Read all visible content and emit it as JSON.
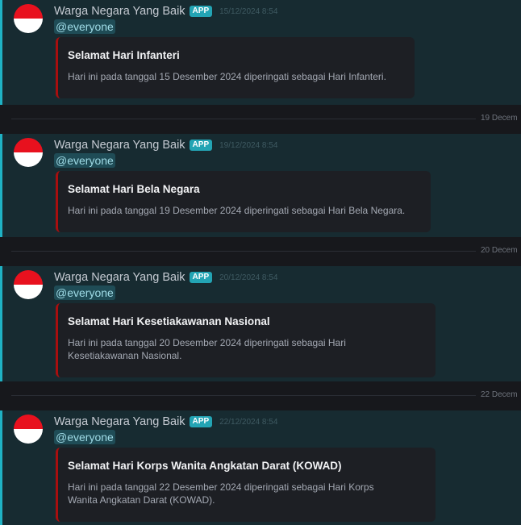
{
  "messages": [
    {
      "author": "Warga Negara Yang Baik",
      "badge": "APP",
      "timestamp": "15/12/2024 8:54",
      "mention": "@everyone",
      "embed_title": "Selamat Hari Infanteri",
      "embed_description": "Hari ini pada tanggal 15 Desember 2024 diperingati sebagai Hari Infanteri."
    },
    {
      "author": "Warga Negara Yang Baik",
      "badge": "APP",
      "timestamp": "19/12/2024 8:54",
      "mention": "@everyone",
      "embed_title": "Selamat Hari Bela Negara",
      "embed_description": "Hari ini pada tanggal 19 Desember 2024 diperingati sebagai Hari Bela Negara."
    },
    {
      "author": "Warga Negara Yang Baik",
      "badge": "APP",
      "timestamp": "20/12/2024 8:54",
      "mention": "@everyone",
      "embed_title": "Selamat Hari Kesetiakawanan Nasional",
      "embed_description_lines": [
        "Hari ini pada tanggal 20 Desember 2024 diperingati sebagai Hari",
        "Kesetiakawanan Nasional."
      ]
    },
    {
      "author": "Warga Negara Yang Baik",
      "badge": "APP",
      "timestamp": "22/12/2024 8:54",
      "mention": "@everyone",
      "embed_title": "Selamat Hari Korps Wanita Angkatan Darat (KOWAD)",
      "embed_description_lines": [
        "Hari ini pada tanggal 22 Desember 2024 diperingati sebagai Hari Korps",
        "Wanita Angkatan Darat (KOWAD)."
      ]
    }
  ],
  "dividers": [
    "19 Decem",
    "20 Decem",
    "22 Decem"
  ],
  "colors": {
    "highlight_bar": "#1fb2c4",
    "embed_accent": "#a80f0f",
    "app_badge": "#23a4b4",
    "flag_red": "#e8111e",
    "flag_white": "#ffffff"
  },
  "icons": {
    "avatar": "indonesia-flag-icon"
  }
}
